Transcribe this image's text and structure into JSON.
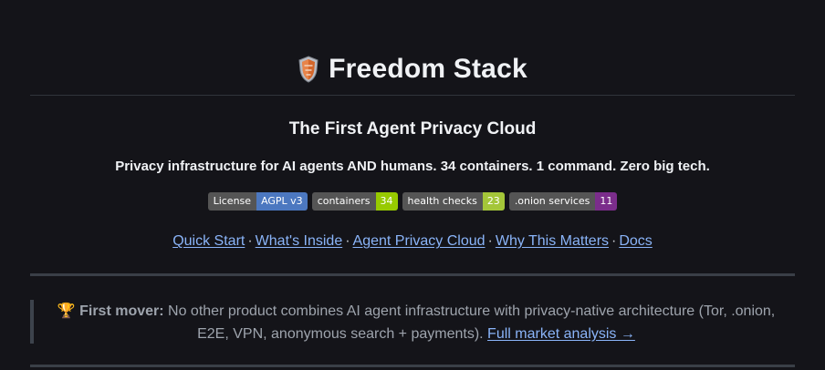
{
  "header": {
    "title": "Freedom Stack",
    "icon": "shield-icon"
  },
  "subtitle": "The First Agent Privacy Cloud",
  "tagline": "Privacy infrastructure for AI agents AND humans. 34 containers. 1 command. Zero big tech.",
  "badges": [
    {
      "label": "License",
      "value": "AGPL v3",
      "color": "#4c78c0"
    },
    {
      "label": "containers",
      "value": "34",
      "color": "#97ca00"
    },
    {
      "label": "health checks",
      "value": "23",
      "color": "#a4c639"
    },
    {
      "label": ".onion services",
      "value": "11",
      "color": "#7b2d8b"
    }
  ],
  "nav": {
    "links": [
      "Quick Start",
      "What's Inside",
      "Agent Privacy Cloud",
      "Why This Matters",
      "Docs"
    ],
    "separator": "·"
  },
  "callout": {
    "icon": "🏆",
    "lead": "First mover:",
    "body": "No other product combines AI agent infrastructure with privacy-native architecture (Tor, .onion, E2E, VPN, anonymous search + payments).",
    "link": "Full market analysis →"
  },
  "colors": {
    "background": "#141419",
    "link": "#8ab4f8",
    "text": "#f0f2f5",
    "muted": "#9ea4ad"
  }
}
